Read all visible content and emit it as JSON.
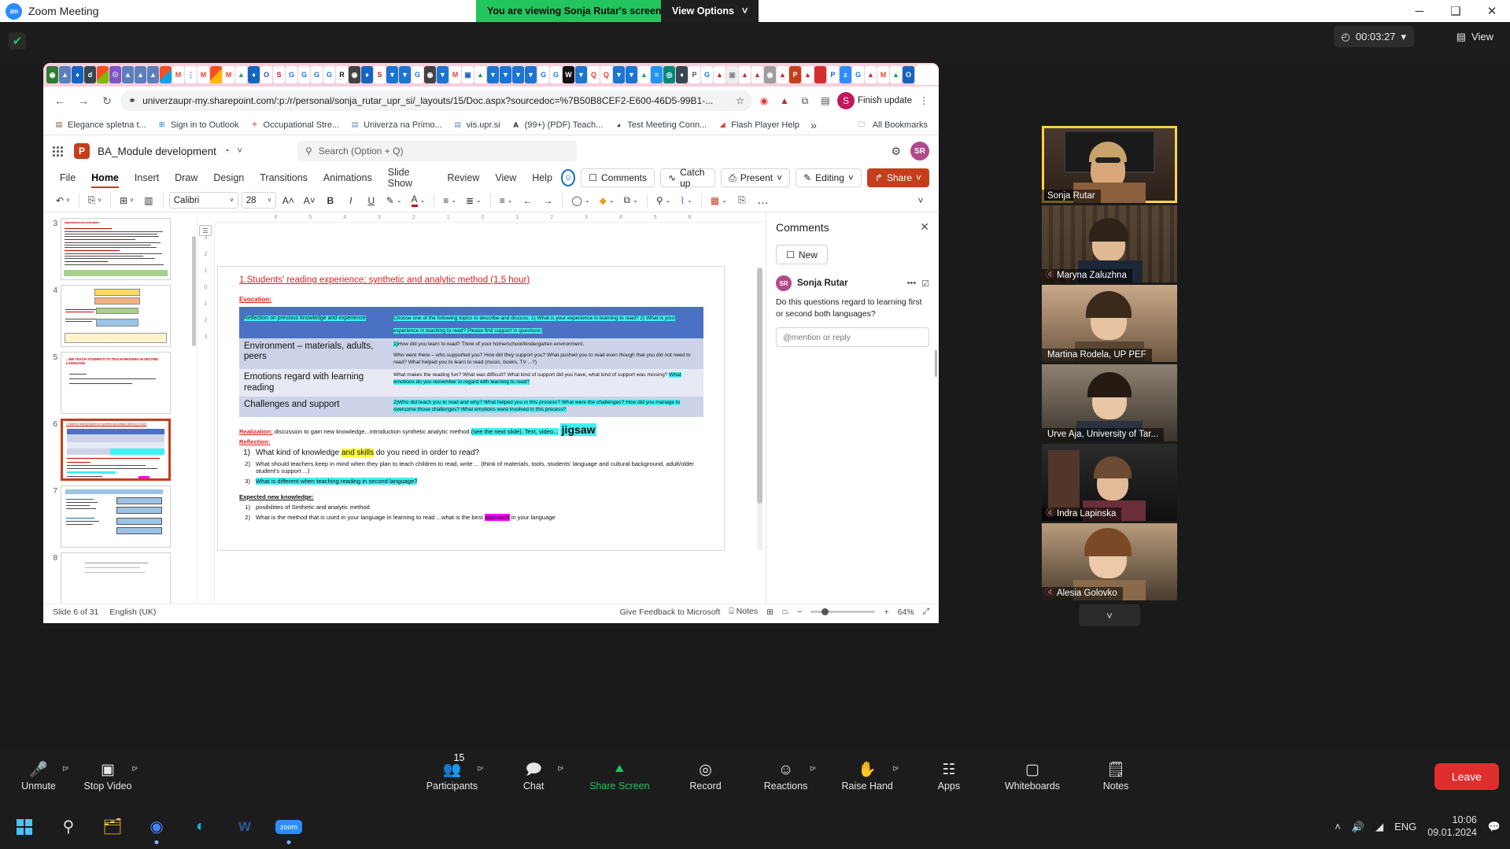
{
  "zoom_window": {
    "app_title": "Zoom Meeting",
    "logo_text": "zm",
    "screenshare_banner": "You are viewing Sonja Rutar's screen",
    "view_options_label": "View Options",
    "view_options_caret": "˅",
    "minimize": "─",
    "maximize": "❑",
    "close": "✕",
    "shield_icon": "✔",
    "recording_timer": "00:03:27",
    "timer_caret": "▾",
    "clock_icon": "◴",
    "view_button": "View",
    "view_icon": "▤"
  },
  "browser": {
    "tabs_note": "many pinned favicon tabs",
    "active_tab_title": "",
    "active_tab_close": "✕",
    "new_tab": "+",
    "tabstrip_caret": "˅",
    "nav": {
      "back": "←",
      "forward": "→",
      "reload": "↻"
    },
    "site_info_icon": "⚭",
    "url": "univerzaupr-my.sharepoint.com/:p:/r/personal/sonja_rutar_upr_si/_layouts/15/Doc.aspx?sourcedoc=%7B50B8CEF2-E600-46D5-99B1-...",
    "bookmark_star": "☆",
    "extensions": [
      "O",
      "A",
      "⧉",
      "▤"
    ],
    "profile_button": "S",
    "finish_update_label": "Finish update",
    "kebab": "⋮",
    "bookmarks": [
      {
        "label": "Elegance spletna t...",
        "icon": "▤"
      },
      {
        "label": "Sign in to Outlook",
        "icon": "⊞"
      },
      {
        "label": "Occupational Stre...",
        "icon": "✳"
      },
      {
        "label": "Univerza na Primo...",
        "icon": "▤"
      },
      {
        "label": "vis.upr.si",
        "icon": "▤"
      },
      {
        "label": "(99+) (PDF) Teach...",
        "icon": "A"
      },
      {
        "label": "Test Meeting Conn...",
        "icon": "◕"
      },
      {
        "label": "Flash Player Help",
        "icon": "◢"
      }
    ],
    "bookmarks_overflow": "»",
    "all_bookmarks_label": "All Bookmarks",
    "all_bookmarks_icon": "🗀"
  },
  "powerpoint": {
    "waffle_icon": "grid-icon",
    "app_badge": "P",
    "document_title": "BA_Module development",
    "sync_icon": "◔",
    "title_caret": "˅",
    "search_placeholder": "Search (Option + Q)",
    "search_icon": "⚲",
    "settings_icon": "⚙",
    "account_initials": "SR",
    "ribbon_tabs": [
      "File",
      "Home",
      "Insert",
      "Draw",
      "Design",
      "Transitions",
      "Animations",
      "Slide Show",
      "Review",
      "View",
      "Help"
    ],
    "active_ribbon_tab": "Home",
    "presence_icon": "☺",
    "comments_button": "Comments",
    "comments_icon": "☐",
    "catchup_button": "Catch up",
    "catchup_icon": "∿",
    "present_button": "Present",
    "present_icon": "⎙",
    "present_caret": "˅",
    "editing_button": "Editing",
    "editing_icon": "✎",
    "editing_caret": "˅",
    "share_button": "Share",
    "share_icon": "↱",
    "share_caret": "˅",
    "toolbar": {
      "undo_icon": "↶",
      "undo_caret": "˅",
      "paste_icon": "⎘",
      "paste_caret": "˅",
      "newslide_icon": "⊞",
      "newslide_caret": "˅",
      "layout_icon": "▥",
      "font_name": "Calibri",
      "font_caret": "˅",
      "font_size": "28",
      "size_caret": "˅",
      "grow_font": "A˄",
      "shrink_font": "A˅",
      "bold": "B",
      "italic": "I",
      "underline": "U",
      "highlight_icon": "✎",
      "font_color_icon": "A",
      "bullets_icon": "≡",
      "bullets_caret": "˅",
      "numbering_icon": "≣",
      "numbering_caret": "˅",
      "align_icon": "≡",
      "align_caret": "˅",
      "indent_left": "←",
      "indent_right": "→",
      "shapes_icon": "◯",
      "shapes_caret": "˅",
      "shape_fill_icon": "◆",
      "shape_fill_caret": "˅",
      "arrange_icon": "⧉",
      "arrange_caret": "˅",
      "find_icon": "⚲",
      "find_caret": "˅",
      "dictate_icon": "⌇",
      "dictate_caret": "˅",
      "designer_icon": "▦",
      "designer_caret": "˅",
      "editor_icon": "⎘",
      "more_icon": "…",
      "collapse_caret": "˅"
    },
    "thumbnails": [
      {
        "number": "3",
        "caption": "Approaches and principles:"
      },
      {
        "number": "4",
        "caption": ""
      },
      {
        "number": "5",
        "caption": "...WE TEACH STUDENTS TO TEACH READING IN SECOND LANGUAGE."
      },
      {
        "number": "6",
        "caption": "1.Students' reading experience; synthetic and analytic method (1,5 hour)"
      },
      {
        "number": "7",
        "caption": ""
      },
      {
        "number": "8",
        "caption": ""
      }
    ],
    "selected_thumbnail": "6",
    "status": {
      "slide_counter": "Slide 6 of 31",
      "language": "English (UK)",
      "feedback": "Give Feedback to Microsoft",
      "notes_label": "Notes",
      "notes_icon": "⌸",
      "view_normal_icon": "⊞",
      "view_sorter_icon": "▦",
      "view_reading_icon": "⏢",
      "zoom_out": "−",
      "zoom_in": "+",
      "zoom_level": "64%",
      "fit_icon": "⤢"
    }
  },
  "slide": {
    "title": "1.Students' reading experience; synthetic and analytic method (1,5 hour)",
    "evocation_label": "Evocation:",
    "table": [
      {
        "left": "Reflection on previous knowledge and experience",
        "left_highlight": "cyan",
        "left_size": "small",
        "right": "Choose one of the following topics to describe and discuss: 1) What is your experience in learning to read? 2) What is your experience in teaching to read? Please find support in questions:",
        "right_highlight": "cyan"
      },
      {
        "left": "Environment – materials, adults, peers",
        "left_size": "large",
        "right_pre": "1)",
        "right": "How did you learn to read? Think of your home/school/kindergarten environment.",
        "right2": "Who were there – who supported you? How did they support you? What pushed you to read even though that you did not need to read? What helped you to learn to read (music, books, TV ...?)"
      },
      {
        "left": "Emotions regard with learning reading",
        "left_size": "large",
        "right": "What makes the reading fun? What was difficult? What kind of support did you have, what kind of support was missing?",
        "right_hl": "What emotions do you remember in regard with learning to read?"
      },
      {
        "left": "Challenges and support",
        "left_size": "large",
        "right_pre": "2)",
        "right_hl_all": "Who did teach you to read and why? What helped you in this process? What were the challenges? How did you manage to overcome those challenges? What emotions were involved in this process?"
      }
    ],
    "realization_label": "Realization:",
    "realization_text": "discussion to gain new knowledge...introduction synthetic analytic method",
    "realization_hl": "(see the next slide). Text, video...",
    "jigsaw": "jigsaw",
    "reflection_label": "Reflection:",
    "reflection_items": [
      {
        "n": "1)",
        "pre": "What kind of knowledge ",
        "hl": "and skills",
        "post": " do you need in order to read?",
        "size": "big"
      },
      {
        "n": "2)",
        "text": "What should teachers keep in mind when they plan to teach children to read, write ... (think of materials, tools, students' language and cultural background, adult/older student's support ...)",
        "size": "small"
      },
      {
        "n": "3)",
        "hl_all": "What is different when teaching reading in second language?",
        "size": "small"
      }
    ],
    "expected_label": "Expected new knowledge:",
    "expected_items": [
      {
        "n": "1)",
        "text": "posibilities of Sinthetic and analytic method"
      },
      {
        "n": "2)",
        "pre": "What is the method that is used in your language in learning to read ...what is the best ",
        "hl": "approach",
        "post": " in your language"
      }
    ]
  },
  "comments_pane": {
    "title": "Comments",
    "close_icon": "✕",
    "new_button": "New",
    "new_icon": "☐",
    "author_initials": "SR",
    "author": "Sonja Rutar",
    "more_icon": "•••",
    "resolve_icon": "☑",
    "text": "Do this questions regard to learning first or second both languages?",
    "reply_placeholder": "@mention or reply"
  },
  "participants": [
    {
      "name": "Sonja Rutar",
      "muted": false,
      "speaking": true
    },
    {
      "name": "Maryna Zaluzhna",
      "muted": true,
      "speaking": false
    },
    {
      "name": "Martina Rodela, UP PEF",
      "muted": false,
      "speaking": false
    },
    {
      "name": "Urve Aja, University of Tar...",
      "muted": false,
      "speaking": false
    },
    {
      "name": "Indra Lapinska",
      "muted": true,
      "speaking": false
    },
    {
      "name": "Alesia Golovko",
      "muted": true,
      "speaking": false
    }
  ],
  "participants_more_icon": "˅",
  "zoom_toolbar": {
    "items": [
      {
        "label": "Unmute",
        "icon": "Ἲ4",
        "caret": true,
        "state": "muted"
      },
      {
        "label": "Stop Video",
        "icon": "▣",
        "caret": true,
        "state": "on"
      },
      {
        "label": "Participants",
        "icon": "὆5",
        "caret": true,
        "count": "15"
      },
      {
        "label": "Chat",
        "icon": "▭",
        "caret": true
      },
      {
        "label": "Share Screen",
        "icon": "⬆",
        "caret": false,
        "state": "sharing"
      },
      {
        "label": "Record",
        "icon": "●",
        "caret": false
      },
      {
        "label": "Reactions",
        "icon": "☺",
        "caret": true
      },
      {
        "label": "Raise Hand",
        "icon": "✋",
        "caret": true
      },
      {
        "label": "Apps",
        "icon": "✥",
        "caret": false
      },
      {
        "label": "Whiteboards",
        "icon": "▭",
        "caret": false
      },
      {
        "label": "Notes",
        "icon": "὜b",
        "caret": false
      }
    ],
    "leave_button": "Leave"
  },
  "taskbar": {
    "start_icon": "windows-icon",
    "search_icon": "⚲",
    "apps": [
      {
        "name": "file-explorer-icon",
        "glyph": "🗀",
        "active": false
      },
      {
        "name": "chrome-icon",
        "glyph": "◉",
        "active": true
      },
      {
        "name": "edge-icon",
        "glyph": "◔",
        "active": false
      },
      {
        "name": "word-icon",
        "glyph": "W",
        "active": false
      },
      {
        "name": "zoom-icon",
        "glyph": "zoom",
        "active": true
      }
    ],
    "tray": {
      "overflow_icon": "˄",
      "volume_icon": "🔊",
      "network_icon": "◢",
      "language": "ENG",
      "time": "10:06",
      "date": "09.01.2024",
      "notifications_icon": "💬"
    }
  }
}
